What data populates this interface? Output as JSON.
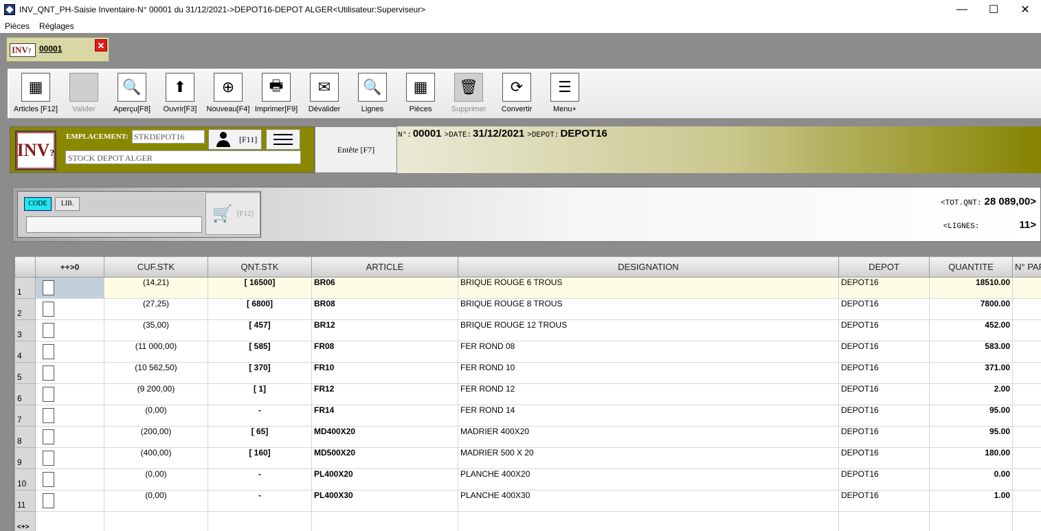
{
  "window": {
    "title": "INV_QNT_PH-Saisie Inventaire-N° 00001 du 31/12/2021->DEPOT16-DEPOT ALGER<Utilisateur:Superviseur>",
    "minimize": "—",
    "maximize": "☐",
    "close": "✕"
  },
  "menu": [
    "Pièces",
    "Réglages"
  ],
  "doc_tab": {
    "icon_text": "INV",
    "icon_suffix": "?",
    "number": "00001",
    "close": "✕"
  },
  "toolbar": [
    {
      "label": "Articles [F12]",
      "icon": "articles-icon",
      "glyph": "▦",
      "enabled": true
    },
    {
      "label": "Valider",
      "icon": "valider-icon",
      "glyph": "",
      "enabled": false
    },
    {
      "label": "Aperçu[F8]",
      "icon": "zoom-icon",
      "glyph": "🔍",
      "enabled": true
    },
    {
      "label": "Ouvrir[F3]",
      "icon": "arrow-up-icon",
      "glyph": "⬆",
      "enabled": true
    },
    {
      "label": "Nouveau[F4]",
      "icon": "plus-icon",
      "glyph": "⊕",
      "enabled": true
    },
    {
      "label": "Imprimer[F9]",
      "icon": "printer-icon",
      "glyph": "🖶",
      "enabled": true
    },
    {
      "label": "Dévalider",
      "icon": "devalider-icon",
      "glyph": "✉",
      "enabled": true
    },
    {
      "label": "Lignes",
      "icon": "search-lines-icon",
      "glyph": "🔍",
      "enabled": true
    },
    {
      "label": "Pièces",
      "icon": "grid-pieces-icon",
      "glyph": "▦",
      "enabled": true
    },
    {
      "label": "Supprimer",
      "icon": "trash-icon",
      "glyph": "🗑",
      "enabled": false
    },
    {
      "label": "Convertir",
      "icon": "convert-icon",
      "glyph": "⟳",
      "enabled": true
    },
    {
      "label": "Menu+",
      "icon": "menu-icon",
      "glyph": "☰",
      "enabled": true
    }
  ],
  "header": {
    "logo_text": "INV",
    "logo_suffix": "?",
    "emplacement_label": "EMPLACEMENT:",
    "emplacement_code": "STKDEPOT16",
    "emplacement_name": "STOCK DEPOT ALGER",
    "user_key": "[F11]",
    "entete_label": "Entête [F7]",
    "num_label": "N°:",
    "num_value": "00001",
    "date_label": ">DATE:",
    "date_value": "31/12/2021",
    "depot_label": ">DEPOT:",
    "depot_value": "DEPOT16"
  },
  "search": {
    "code_label": "CODE",
    "lib_label": "LIB.",
    "input_value": "",
    "cart_key": "[F12]",
    "tot_label": "<TOT.QNT:",
    "tot_value": "28 089,00>",
    "lignes_label": "<LIGNES:",
    "lignes_value": "11>"
  },
  "grid": {
    "columns": [
      "",
      "++>0",
      "CUF.STK",
      "QNT.STK",
      "ARTICLE",
      "DESIGNATION",
      "DEPOT",
      "QUANTITE",
      "N° PAR"
    ],
    "rows": [
      {
        "n": "1",
        "cuf": "(14,21)",
        "qnt": "[ 16500]",
        "article": "BR06",
        "designation": "BRIQUE ROUGE 6 TROUS",
        "depot": "DEPOT16",
        "quantite": "18510.00"
      },
      {
        "n": "2",
        "cuf": "(27,25)",
        "qnt": "[ 6800]",
        "article": "BR08",
        "designation": "BRIQUE ROUGE 8 TROUS",
        "depot": "DEPOT16",
        "quantite": "7800.00"
      },
      {
        "n": "3",
        "cuf": "(35,00)",
        "qnt": "[ 457]",
        "article": "BR12",
        "designation": "BRIQUE ROUGE 12 TROUS",
        "depot": "DEPOT16",
        "quantite": "452.00"
      },
      {
        "n": "4",
        "cuf": "(11 000,00)",
        "qnt": "[ 585]",
        "article": "FR08",
        "designation": "FER ROND 08",
        "depot": "DEPOT16",
        "quantite": "583.00"
      },
      {
        "n": "5",
        "cuf": "(10 562,50)",
        "qnt": "[ 370]",
        "article": "FR10",
        "designation": "FER ROND 10",
        "depot": "DEPOT16",
        "quantite": "371.00"
      },
      {
        "n": "6",
        "cuf": "(9 200,00)",
        "qnt": "[ 1]",
        "article": "FR12",
        "designation": "FER ROND 12",
        "depot": "DEPOT16",
        "quantite": "2.00"
      },
      {
        "n": "7",
        "cuf": "(0,00)",
        "qnt": "-",
        "article": "FR14",
        "designation": "FER ROND 14",
        "depot": "DEPOT16",
        "quantite": "95.00"
      },
      {
        "n": "8",
        "cuf": "(200,00)",
        "qnt": "[ 65]",
        "article": "MD400X20",
        "designation": "MADRIER 400X20",
        "depot": "DEPOT16",
        "quantite": "95.00"
      },
      {
        "n": "9",
        "cuf": "(400,00)",
        "qnt": "[ 160]",
        "article": "MD500X20",
        "designation": "MADRIER 500 X 20",
        "depot": "DEPOT16",
        "quantite": "180.00"
      },
      {
        "n": "10",
        "cuf": "(0,00)",
        "qnt": "-",
        "article": "PL400X20",
        "designation": "PLANCHE 400X20",
        "depot": "DEPOT16",
        "quantite": "0.00"
      },
      {
        "n": "11",
        "cuf": "(0,00)",
        "qnt": "-",
        "article": "PL400X30",
        "designation": "PLANCHE 400X30",
        "depot": "DEPOT16",
        "quantite": "1.00"
      }
    ],
    "footer_marker": "<+>"
  }
}
